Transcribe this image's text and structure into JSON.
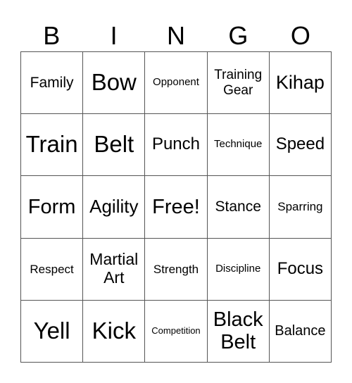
{
  "header": {
    "letters": [
      "B",
      "I",
      "N",
      "G",
      "O"
    ]
  },
  "grid": {
    "rows": [
      [
        "Family",
        "Bow",
        "Opponent",
        "Training Gear",
        "Kihap"
      ],
      [
        "Train",
        "Belt",
        "Punch",
        "Technique",
        "Speed"
      ],
      [
        "Form",
        "Agility",
        "Free!",
        "Stance",
        "Sparring"
      ],
      [
        "Respect",
        "Martial Art",
        "Strength",
        "Discipline",
        "Focus"
      ],
      [
        "Yell",
        "Kick",
        "Competition",
        "Black Belt",
        "Balance"
      ]
    ]
  }
}
